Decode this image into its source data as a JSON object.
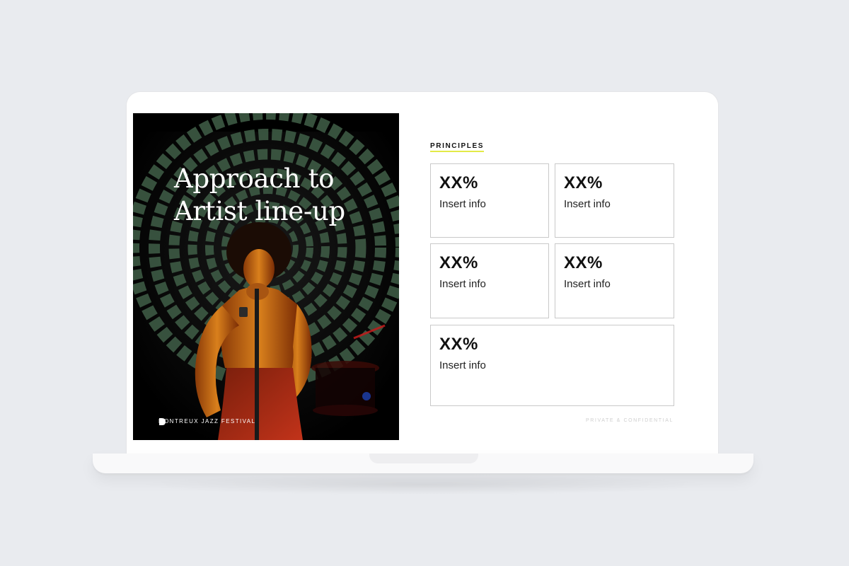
{
  "hero": {
    "title_line1": "Approach to",
    "title_line2": "Artist line-up",
    "brand": "MONTREUX JAZZ FESTIVAL"
  },
  "section": {
    "label": "PRINCIPLES"
  },
  "cards": [
    {
      "value": "XX%",
      "info": "Insert info"
    },
    {
      "value": "XX%",
      "info": "Insert info"
    },
    {
      "value": "XX%",
      "info": "Insert info"
    },
    {
      "value": "XX%",
      "info": "Insert info"
    },
    {
      "value": "XX%",
      "info": "Insert info"
    }
  ],
  "footer": {
    "note": "PRIVATE & CONFIDENTIAL"
  },
  "colors": {
    "accent_underline": "#e3ea47",
    "page_background": "#e9ebef",
    "card_border": "#c9c9c9"
  }
}
